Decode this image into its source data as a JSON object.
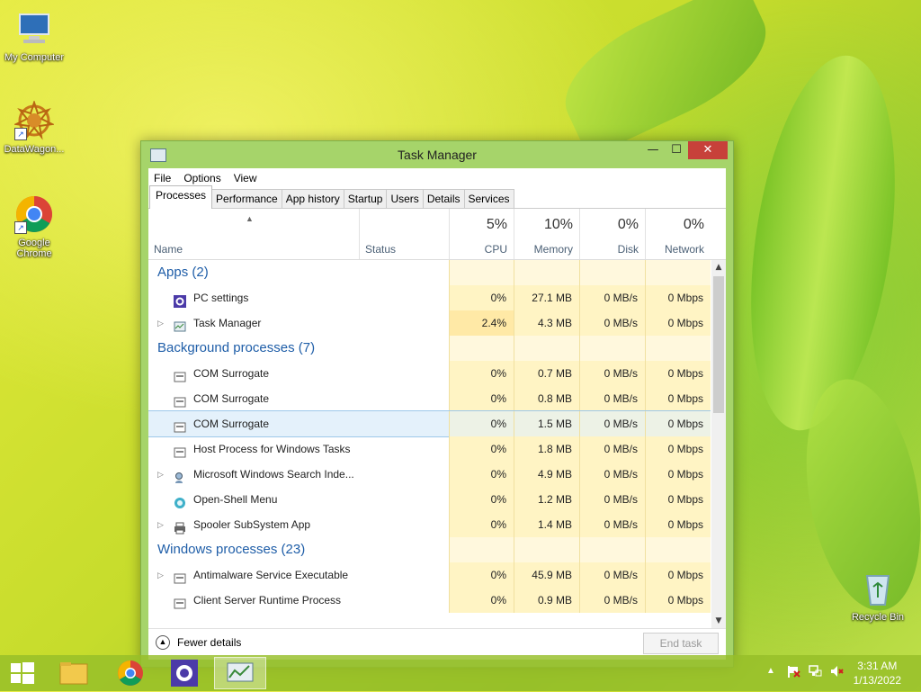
{
  "desktop": {
    "icons": [
      {
        "label": "My Computer",
        "icon": "computer-icon"
      },
      {
        "label": "DataWagon...",
        "icon": "datawagon-icon"
      },
      {
        "label": "Google Chrome",
        "icon": "chrome-icon"
      },
      {
        "label": "Recycle Bin",
        "icon": "recycle-bin-icon"
      }
    ]
  },
  "window": {
    "title": "Task Manager",
    "controls": {
      "minimize": "—",
      "maximize": "☐",
      "close": "✕"
    },
    "menu": [
      "File",
      "Options",
      "View"
    ],
    "tabs": [
      "Processes",
      "Performance",
      "App history",
      "Startup",
      "Users",
      "Details",
      "Services"
    ],
    "active_tab": "Processes",
    "columns": {
      "name": "Name",
      "status": "Status",
      "cpu": {
        "pct": "5%",
        "label": "CPU"
      },
      "memory": {
        "pct": "10%",
        "label": "Memory"
      },
      "disk": {
        "pct": "0%",
        "label": "Disk"
      },
      "network": {
        "pct": "0%",
        "label": "Network"
      }
    },
    "groups": {
      "apps": "Apps (2)",
      "background": "Background processes (7)",
      "windows": "Windows processes (23)"
    },
    "apps": [
      {
        "name": "PC settings",
        "cpu": "0%",
        "memory": "27.1 MB",
        "disk": "0 MB/s",
        "network": "0 Mbps"
      },
      {
        "name": "Task Manager",
        "cpu": "2.4%",
        "memory": "4.3 MB",
        "disk": "0 MB/s",
        "network": "0 Mbps"
      }
    ],
    "background": [
      {
        "name": "COM Surrogate",
        "cpu": "0%",
        "memory": "0.7 MB",
        "disk": "0 MB/s",
        "network": "0 Mbps"
      },
      {
        "name": "COM Surrogate",
        "cpu": "0%",
        "memory": "0.8 MB",
        "disk": "0 MB/s",
        "network": "0 Mbps"
      },
      {
        "name": "COM Surrogate",
        "cpu": "0%",
        "memory": "1.5 MB",
        "disk": "0 MB/s",
        "network": "0 Mbps"
      },
      {
        "name": "Host Process for Windows Tasks",
        "cpu": "0%",
        "memory": "1.8 MB",
        "disk": "0 MB/s",
        "network": "0 Mbps"
      },
      {
        "name": "Microsoft Windows Search Inde...",
        "cpu": "0%",
        "memory": "4.9 MB",
        "disk": "0 MB/s",
        "network": "0 Mbps"
      },
      {
        "name": "Open-Shell Menu",
        "cpu": "0%",
        "memory": "1.2 MB",
        "disk": "0 MB/s",
        "network": "0 Mbps"
      },
      {
        "name": "Spooler SubSystem App",
        "cpu": "0%",
        "memory": "1.4 MB",
        "disk": "0 MB/s",
        "network": "0 Mbps"
      }
    ],
    "windows_procs": [
      {
        "name": "Antimalware Service Executable",
        "cpu": "0%",
        "memory": "45.9 MB",
        "disk": "0 MB/s",
        "network": "0 Mbps"
      },
      {
        "name": "Client Server Runtime Process",
        "cpu": "0%",
        "memory": "0.9 MB",
        "disk": "0 MB/s",
        "network": "0 Mbps"
      }
    ],
    "footer": {
      "fewer_details": "Fewer details",
      "end_task": "End task"
    }
  },
  "taskbar": {
    "time": "3:31 AM",
    "date": "1/13/2022"
  }
}
